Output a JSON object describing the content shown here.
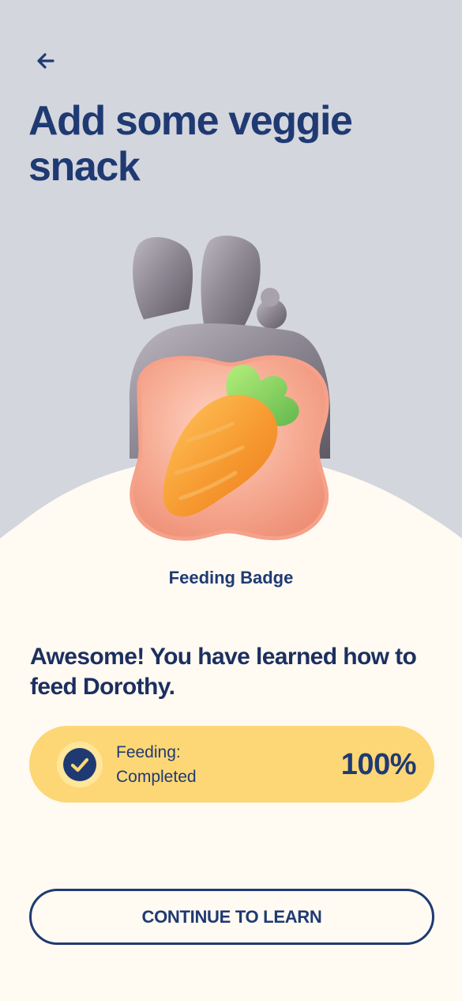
{
  "header": {
    "back_icon": "arrow-left-icon",
    "title": "Add some veggie snack"
  },
  "hero": {
    "rabbit_icon": "rabbit-silhouette",
    "badge_icon": "carrot-badge-icon",
    "badge_label": "Feeding Badge"
  },
  "message": {
    "text": "Awesome! You have learned how to feed Dorothy."
  },
  "progress": {
    "status_icon": "check-circle-icon",
    "line1": "Feeding:",
    "line2": "Completed",
    "value": "100%",
    "fraction": 1.0
  },
  "actions": {
    "continue_label": "CONTINUE TO LEARN"
  },
  "colors": {
    "background_top": "#d4d6dd",
    "cream_panel": "#fffaf2",
    "navy": "#1f3a73",
    "yellow_card": "#fdd776",
    "badge_pink": "#f8b39c",
    "carrot_orange": "#f7972f",
    "leaf_green": "#8fd66b",
    "rabbit_gray": "#8c8791"
  }
}
